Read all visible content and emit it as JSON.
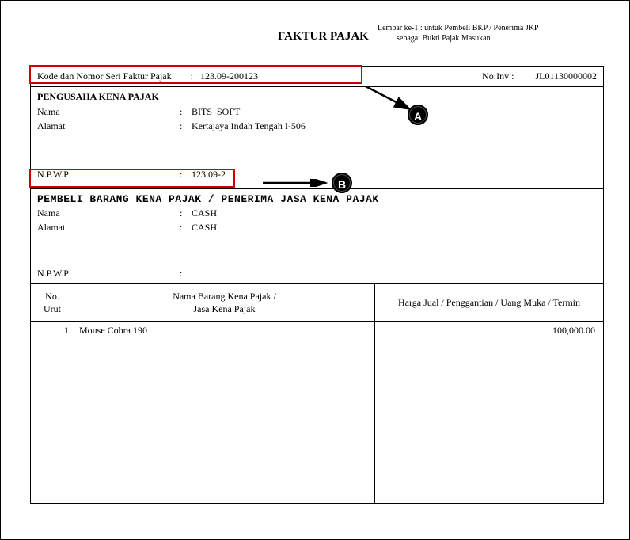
{
  "header": {
    "line1": "Lembar ke-1 : untuk Pembeli BKP / Penerima JKP",
    "line2": "sebagai Bukti Pajak Masukan",
    "title": "FAKTUR PAJAK"
  },
  "kode": {
    "label": "Kode dan Nomor Seri Faktur Pajak",
    "value": "123.09-200123",
    "noinv_label": "No:Inv :",
    "noinv_value": "JL01130000002"
  },
  "pkp": {
    "header": "PENGUSAHA KENA PAJAK",
    "nama_label": "Nama",
    "nama_value": "BITS_SOFT",
    "alamat_label": "Alamat",
    "alamat_value": "Kertajaya Indah Tengah I-506",
    "npwp_label": "N.P.W.P",
    "npwp_value": "123.09-2"
  },
  "pembeli": {
    "header": "PEMBELI BARANG KENA PAJAK / PENERIMA JASA KENA PAJAK",
    "nama_label": "Nama",
    "nama_value": "CASH",
    "alamat_label": "Alamat",
    "alamat_value": "CASH",
    "npwp_label": "N.P.W.P",
    "npwp_value": ""
  },
  "table": {
    "col_urut_l1": "No.",
    "col_urut_l2": "Urut",
    "col_nama_l1": "Nama Barang Kena Pajak /",
    "col_nama_l2": "Jasa Kena Pajak",
    "col_harga": "Harga Jual / Penggantian / Uang Muka / Termin",
    "rows": [
      {
        "no": "1",
        "nama": "Mouse Cobra 190",
        "harga": "100,000.00"
      }
    ]
  },
  "markers": {
    "a": "A",
    "b": "B"
  }
}
